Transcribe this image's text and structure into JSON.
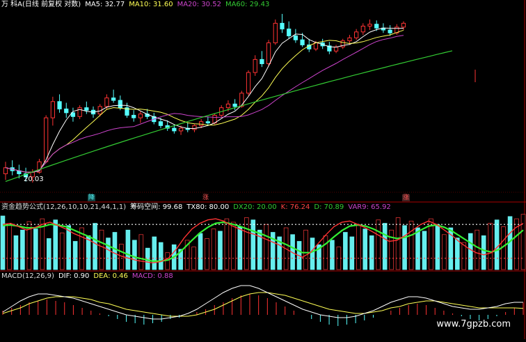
{
  "colors": {
    "up": "#ff3333",
    "down": "#55ffff",
    "ma5": "#ffffff",
    "ma10": "#ffff55",
    "ma20": "#cc44cc",
    "ma60": "#33cc33",
    "border": "#aa0000"
  },
  "main_header": {
    "title": "万 科A(日线 前复权 对数)",
    "ma5": "MA5: 32.77",
    "ma10": "MA10: 31.60",
    "ma20": "MA20: 30.52",
    "ma60": "MA60: 29.43"
  },
  "indicator_header": {
    "name": "资金趋势公式(12,26,10,10,21,44,1,1)",
    "chip": "筹码空间: 99.68",
    "tx80": "TX80: 80.00",
    "dx20": "DX20: 20.00",
    "k": "K: 76.24",
    "d": "D: 70.89",
    "var9": "VAR9: 65.92"
  },
  "macd_header": {
    "name": "MACD(12,26,9)",
    "dif": "DIF: 0.90",
    "dea": "DEA: 0.46",
    "macd": "MACD: 0.88"
  },
  "low_label": "20.03",
  "signals": {
    "down_mark": "降",
    "up_mark1": "涨",
    "up_mark2": "涨"
  },
  "watermark": "www.7gpzb.com",
  "chart_data": [
    {
      "type": "candlestick",
      "title": "万 科A(日线 前复权 对数)",
      "ohlc": [
        [
          20.6,
          21.4,
          20.2,
          21.0
        ],
        [
          21.0,
          21.5,
          20.5,
          20.8
        ],
        [
          20.8,
          21.2,
          20.3,
          20.6
        ],
        [
          20.6,
          21.0,
          20.1,
          20.4
        ],
        [
          20.4,
          20.9,
          20.03,
          20.7
        ],
        [
          20.7,
          21.6,
          20.6,
          21.4
        ],
        [
          21.4,
          24.8,
          21.3,
          24.6
        ],
        [
          24.6,
          26.3,
          24.0,
          25.9
        ],
        [
          25.9,
          26.5,
          25.0,
          25.3
        ],
        [
          25.3,
          25.8,
          24.6,
          25.0
        ],
        [
          25.0,
          25.4,
          24.3,
          24.7
        ],
        [
          24.7,
          25.6,
          24.5,
          25.4
        ],
        [
          25.4,
          25.9,
          24.9,
          25.2
        ],
        [
          25.2,
          25.5,
          24.6,
          24.9
        ],
        [
          24.9,
          25.7,
          24.7,
          25.5
        ],
        [
          25.5,
          26.5,
          25.3,
          26.2
        ],
        [
          26.2,
          26.9,
          25.8,
          26.0
        ],
        [
          26.0,
          26.4,
          25.2,
          25.4
        ],
        [
          25.4,
          25.8,
          24.6,
          24.8
        ],
        [
          24.8,
          25.2,
          24.3,
          24.6
        ],
        [
          24.6,
          25.1,
          24.2,
          24.9
        ],
        [
          24.9,
          25.3,
          24.5,
          24.7
        ],
        [
          24.7,
          25.0,
          24.1,
          24.3
        ],
        [
          24.3,
          24.6,
          23.8,
          24.0
        ],
        [
          24.0,
          24.4,
          23.6,
          23.8
        ],
        [
          23.8,
          24.1,
          23.4,
          23.6
        ],
        [
          23.6,
          24.0,
          23.3,
          23.8
        ],
        [
          23.8,
          24.2,
          23.5,
          23.7
        ],
        [
          23.7,
          24.1,
          23.5,
          24.0
        ],
        [
          24.0,
          24.5,
          23.8,
          24.3
        ],
        [
          24.3,
          24.7,
          24.0,
          24.2
        ],
        [
          24.2,
          24.9,
          24.1,
          24.8
        ],
        [
          24.8,
          25.6,
          24.6,
          25.4
        ],
        [
          25.4,
          26.0,
          25.1,
          25.7
        ],
        [
          25.7,
          26.1,
          25.2,
          25.5
        ],
        [
          25.5,
          26.8,
          25.4,
          26.6
        ],
        [
          26.6,
          28.6,
          26.4,
          28.4
        ],
        [
          28.4,
          30.0,
          28.1,
          29.6
        ],
        [
          29.6,
          30.4,
          28.9,
          29.2
        ],
        [
          29.2,
          31.5,
          29.0,
          31.2
        ],
        [
          31.2,
          33.6,
          31.0,
          33.2
        ],
        [
          33.2,
          34.2,
          32.2,
          32.6
        ],
        [
          32.6,
          33.4,
          31.6,
          31.9
        ],
        [
          31.9,
          32.6,
          31.2,
          31.5
        ],
        [
          31.5,
          32.2,
          30.8,
          31.0
        ],
        [
          31.0,
          31.6,
          30.3,
          30.6
        ],
        [
          30.6,
          31.4,
          30.4,
          31.2
        ],
        [
          31.2,
          31.6,
          30.6,
          30.9
        ],
        [
          30.9,
          31.3,
          30.1,
          30.4
        ],
        [
          30.4,
          31.0,
          30.2,
          30.8
        ],
        [
          30.8,
          31.6,
          30.6,
          31.4
        ],
        [
          31.4,
          32.0,
          31.0,
          31.7
        ],
        [
          31.7,
          32.6,
          31.5,
          32.3
        ],
        [
          32.3,
          33.2,
          32.0,
          32.9
        ],
        [
          32.9,
          33.6,
          32.5,
          33.1
        ],
        [
          33.1,
          33.5,
          32.4,
          32.7
        ],
        [
          32.7,
          33.2,
          32.2,
          32.5
        ],
        [
          32.5,
          33.0,
          31.9,
          32.2
        ],
        [
          32.2,
          33.1,
          32.0,
          32.8
        ],
        [
          32.8,
          33.4,
          32.5,
          33.2
        ]
      ],
      "ma_labels": [
        "MA5",
        "MA10",
        "MA20",
        "MA60"
      ],
      "low_marker": 20.03,
      "ylim": [
        19.6,
        34.5
      ]
    },
    {
      "type": "bar",
      "title": "资金趋势公式(12,26,10,10,21,44,1,1)",
      "bar_values": [
        95,
        80,
        60,
        70,
        85,
        72,
        90,
        55,
        88,
        65,
        78,
        50,
        74,
        60,
        82,
        70,
        56,
        66,
        45,
        70,
        52,
        62,
        38,
        58,
        48,
        30,
        44,
        36,
        52,
        40,
        64,
        55,
        72,
        68,
        90,
        84,
        76,
        92,
        88,
        70,
        80,
        66,
        58,
        74,
        62,
        50,
        70,
        56,
        44,
        60,
        52,
        40,
        66,
        58,
        80,
        72,
        60,
        88,
        82,
        70,
        92,
        78,
        86,
        74,
        68,
        90,
        80,
        62,
        74,
        56,
        48,
        64,
        70,
        60,
        82,
        88,
        76,
        94,
        90,
        98
      ],
      "bar_colors": [
        "c",
        "r",
        "c",
        "c",
        "r",
        "c",
        "r",
        "c",
        "c",
        "r",
        "c",
        "c",
        "r",
        "c",
        "c",
        "r",
        "c",
        "c",
        "r",
        "c",
        "c",
        "r",
        "c",
        "c",
        "c",
        "r",
        "c",
        "c",
        "r",
        "r",
        "c",
        "r",
        "r",
        "c",
        "r",
        "r",
        "c",
        "r",
        "c",
        "c",
        "r",
        "c",
        "c",
        "r",
        "c",
        "c",
        "r",
        "c",
        "c",
        "r",
        "c",
        "r",
        "c",
        "c",
        "r",
        "c",
        "c",
        "r",
        "c",
        "r",
        "r",
        "c",
        "r",
        "c",
        "c",
        "r",
        "c",
        "r",
        "c",
        "c",
        "r",
        "c",
        "r",
        "c",
        "r",
        "c",
        "r",
        "c",
        "r",
        "r"
      ],
      "k_line": [
        80,
        82,
        76,
        70,
        74,
        80,
        84,
        78,
        72,
        64,
        58,
        52,
        44,
        38,
        30,
        24,
        20,
        16,
        14,
        12,
        14,
        20,
        36,
        56,
        72,
        82,
        88,
        90,
        86,
        78,
        72,
        66,
        62,
        56,
        50,
        44,
        36,
        28,
        22,
        30,
        46,
        62,
        76,
        84,
        86,
        80,
        74,
        66,
        58,
        50,
        52,
        60,
        70,
        80,
        86,
        80,
        70,
        60,
        48,
        38,
        30,
        26,
        30,
        44,
        60,
        74,
        82
      ],
      "d_line": [
        78,
        79,
        77,
        74,
        74,
        76,
        80,
        79,
        76,
        70,
        64,
        58,
        51,
        45,
        38,
        32,
        26,
        21,
        18,
        15,
        15,
        17,
        25,
        38,
        52,
        65,
        75,
        82,
        84,
        81,
        77,
        72,
        67,
        62,
        56,
        50,
        44,
        37,
        30,
        30,
        36,
        46,
        58,
        69,
        77,
        79,
        77,
        72,
        65,
        58,
        55,
        57,
        62,
        70,
        77,
        79,
        75,
        68,
        59,
        50,
        41,
        34,
        31,
        36,
        46,
        58,
        70
      ]
    },
    {
      "type": "bar",
      "title": "MACD(12,26,9)",
      "hist": [
        0.3,
        0.5,
        0.7,
        0.9,
        1.0,
        1.1,
        1.0,
        0.9,
        0.7,
        0.5,
        0.3,
        0.1,
        -0.1,
        -0.3,
        -0.5,
        -0.6,
        -0.7,
        -0.6,
        -0.5,
        -0.3,
        -0.2,
        0.0,
        0.2,
        0.4,
        0.7,
        0.9,
        1.2,
        1.4,
        1.5,
        1.4,
        1.2,
        0.9,
        0.6,
        0.3,
        0.0,
        -0.3,
        -0.5,
        -0.7,
        -0.8,
        -0.7,
        -0.6,
        -0.4,
        -0.2,
        0.0,
        0.3,
        0.5,
        0.7,
        0.8,
        0.7,
        0.5,
        0.3,
        0.1,
        -0.1,
        -0.3,
        -0.4,
        -0.3,
        -0.1,
        0.2,
        0.5,
        0.88
      ],
      "dif": [
        0.2,
        0.6,
        1.0,
        1.3,
        1.5,
        1.5,
        1.4,
        1.3,
        1.2,
        1.0,
        0.8,
        0.6,
        0.4,
        0.2,
        0.0,
        -0.1,
        -0.2,
        -0.3,
        -0.3,
        -0.2,
        -0.1,
        0.1,
        0.4,
        0.8,
        1.2,
        1.6,
        1.9,
        2.1,
        2.1,
        1.9,
        1.6,
        1.3,
        1.0,
        0.7,
        0.4,
        0.2,
        0.0,
        -0.1,
        -0.2,
        -0.2,
        -0.1,
        0.1,
        0.3,
        0.6,
        0.9,
        1.1,
        1.3,
        1.3,
        1.2,
        1.0,
        0.8,
        0.6,
        0.5,
        0.4,
        0.4,
        0.5,
        0.6,
        0.8,
        0.9,
        0.9
      ],
      "dea": [
        0.1,
        0.3,
        0.5,
        0.8,
        1.0,
        1.2,
        1.3,
        1.3,
        1.3,
        1.2,
        1.1,
        0.9,
        0.8,
        0.6,
        0.4,
        0.3,
        0.2,
        0.1,
        0.0,
        -0.1,
        -0.1,
        -0.1,
        0.0,
        0.2,
        0.4,
        0.7,
        1.0,
        1.3,
        1.5,
        1.6,
        1.6,
        1.5,
        1.4,
        1.2,
        1.0,
        0.8,
        0.6,
        0.4,
        0.3,
        0.2,
        0.1,
        0.1,
        0.2,
        0.3,
        0.5,
        0.6,
        0.8,
        0.9,
        1.0,
        1.0,
        0.9,
        0.8,
        0.7,
        0.6,
        0.5,
        0.5,
        0.5,
        0.5,
        0.5,
        0.46
      ],
      "xlabel": "",
      "ylabel": ""
    }
  ]
}
